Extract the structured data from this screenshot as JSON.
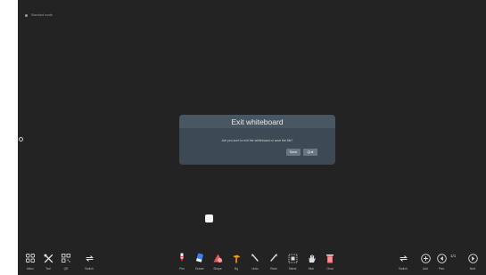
{
  "topbar": {
    "label": "Standard mode"
  },
  "dialog": {
    "title": "Exit whiteboard",
    "message": "Are you sure to exit the whiteboard or save the file?",
    "save_label": "Save",
    "quit_label": "Quit"
  },
  "toolbar": {
    "left": [
      {
        "label": "Menu",
        "icon": "menu-grid-icon"
      },
      {
        "label": "Tool",
        "icon": "tools-icon"
      },
      {
        "label": "QR",
        "icon": "qr-code-icon"
      },
      {
        "label": "Switch",
        "icon": "switch-arrows-icon"
      }
    ],
    "center": [
      {
        "label": "Pen",
        "icon": "pen-icon"
      },
      {
        "label": "Eraser",
        "icon": "eraser-icon"
      },
      {
        "label": "Shape",
        "icon": "shape-icon"
      },
      {
        "label": "Bg",
        "icon": "background-icon"
      },
      {
        "label": "Undo",
        "icon": "undo-icon"
      },
      {
        "label": "Redo",
        "icon": "redo-icon"
      },
      {
        "label": "Select",
        "icon": "select-icon"
      },
      {
        "label": "Mob",
        "icon": "hand-icon"
      },
      {
        "label": "Clear",
        "icon": "clear-icon"
      }
    ],
    "right": [
      {
        "label": "Switch",
        "icon": "switch-arrows-icon"
      },
      {
        "label": "Add",
        "icon": "add-page-icon"
      },
      {
        "label": "Prev",
        "icon": "previous-page-icon"
      },
      {
        "label": "Next",
        "icon": "next-page-icon"
      }
    ],
    "page_indicator": "1/1"
  },
  "colors": {
    "screen_bg": "#232323",
    "dialog_bg": "#3e4c58",
    "button_bg": "#6d7a86",
    "pen_red": "#e53935",
    "eraser_blue": "#3b82f6",
    "shape_red": "#e85a5a",
    "bg_orange": "#f59e0b",
    "clear_red": "#ff6b6b"
  }
}
